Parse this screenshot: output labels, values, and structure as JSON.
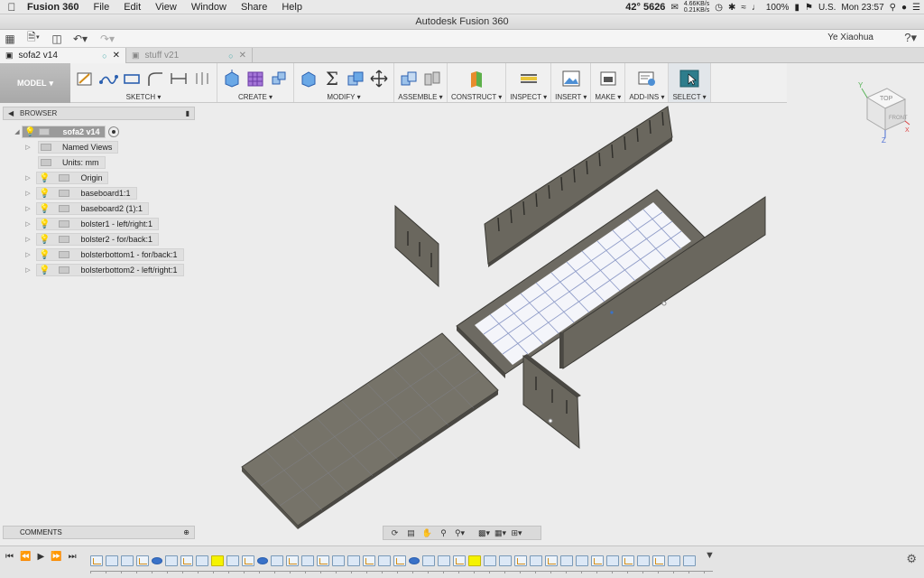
{
  "menubar": {
    "app": "Fusion 360",
    "items": [
      "File",
      "Edit",
      "View",
      "Window",
      "Share",
      "Help"
    ],
    "temperature": "42° 5626",
    "net_up": "4.66KB/s",
    "net_down": "0.21KB/s",
    "battery": "100%",
    "locale": "U.S.",
    "clock": "Mon 23:57"
  },
  "window": {
    "title": "Autodesk Fusion 360"
  },
  "quickaccess": {
    "user": "Ye Xiaohua",
    "help": "?"
  },
  "tabs": [
    {
      "label": "sofa2 v14",
      "active": true
    },
    {
      "label": "stuff v21",
      "active": false
    }
  ],
  "toolbar": {
    "workspace": "MODEL",
    "groups": [
      "SKETCH",
      "CREATE",
      "MODIFY",
      "ASSEMBLE",
      "CONSTRUCT",
      "INSPECT",
      "INSERT",
      "MAKE",
      "ADD-INS",
      "SELECT"
    ]
  },
  "browser": {
    "title": "BROWSER",
    "root": "sofa2 v14",
    "items": [
      {
        "label": "Named Views",
        "type": "folder",
        "expandable": true
      },
      {
        "label": "Units: mm",
        "type": "units",
        "expandable": false
      },
      {
        "label": "Origin",
        "type": "folder",
        "expandable": true
      },
      {
        "label": "baseboard1:1",
        "type": "component",
        "expandable": true
      },
      {
        "label": "baseboard2 (1):1",
        "type": "component",
        "expandable": true
      },
      {
        "label": "bolster1 - left/right:1",
        "type": "component",
        "expandable": true
      },
      {
        "label": "bolster2 - for/back:1",
        "type": "component",
        "expandable": true
      },
      {
        "label": "bolsterbottom1 - for/back:1",
        "type": "component",
        "expandable": true
      },
      {
        "label": "bolsterbottom2 - left/right:1",
        "type": "component",
        "expandable": true
      }
    ]
  },
  "viewcube": {
    "top": "TOP",
    "front": "FRONT",
    "axis_x": "X",
    "axis_y": "Y",
    "axis_z": "Z"
  },
  "comments": {
    "title": "COMMENTS"
  },
  "icons": {
    "colors": {
      "accent": "#3a72c8",
      "select": "#3a8fd0",
      "highlight": "#f5f300",
      "body": "#7b776c"
    }
  },
  "timeline": {
    "items": [
      "sk",
      "ex",
      "ex",
      "sk",
      "jn",
      "ex",
      "sk",
      "ex",
      "hl",
      "ex",
      "sk",
      "jn",
      "ex",
      "sk",
      "ex",
      "sk",
      "ex",
      "ex",
      "sk",
      "ex",
      "sk",
      "jn",
      "ex",
      "ex",
      "sk",
      "hl",
      "ex",
      "ex",
      "sk",
      "ex",
      "sk",
      "ex",
      "ex",
      "sk",
      "ex",
      "sk",
      "ex",
      "sk",
      "ex",
      "ex"
    ]
  }
}
